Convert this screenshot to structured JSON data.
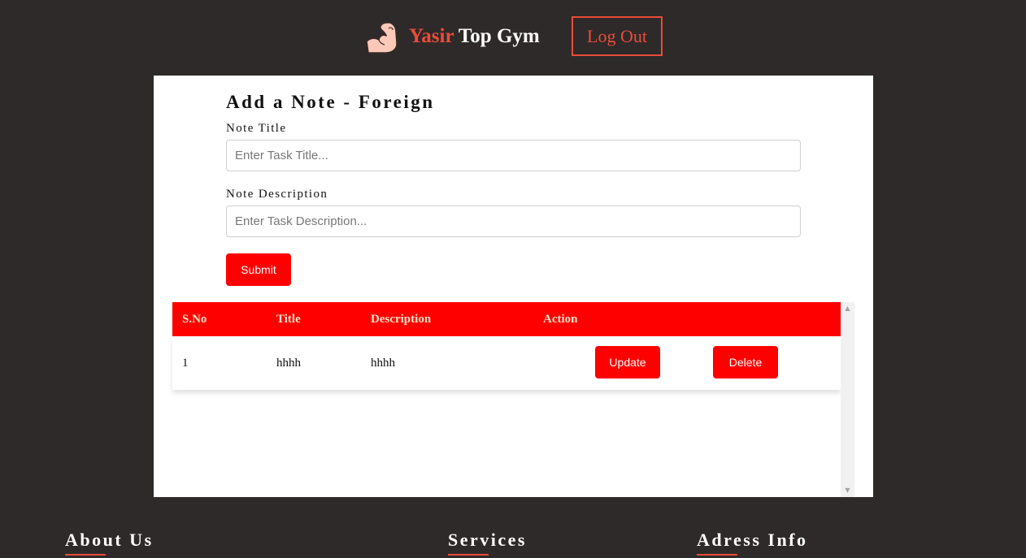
{
  "header": {
    "logo_icon": "flexed-biceps-icon",
    "brand_first": "Yasir",
    "brand_second": "Top Gym",
    "logout_label": "Log Out"
  },
  "form": {
    "title": "Add a Note - Foreign",
    "note_title_label": "Note Title",
    "note_title_placeholder": "Enter Task Title...",
    "note_title_value": "",
    "note_desc_label": "Note Description",
    "note_desc_placeholder": "Enter Task Description...",
    "note_desc_value": "",
    "submit_label": "Submit"
  },
  "table": {
    "headers": [
      "S.No",
      "Title",
      "Description",
      "Action"
    ],
    "rows": [
      {
        "sno": "1",
        "title": "hhhh",
        "description": "hhhh",
        "update_label": "Update",
        "delete_label": "Delete"
      }
    ]
  },
  "footer": {
    "about": "About Us",
    "services": "Services",
    "address": "Adress Info"
  },
  "colors": {
    "page_bg": "#2e2a29",
    "accent": "#ea4c3a",
    "button_red": "#ff0000",
    "header_text": "#ffe3c8"
  }
}
